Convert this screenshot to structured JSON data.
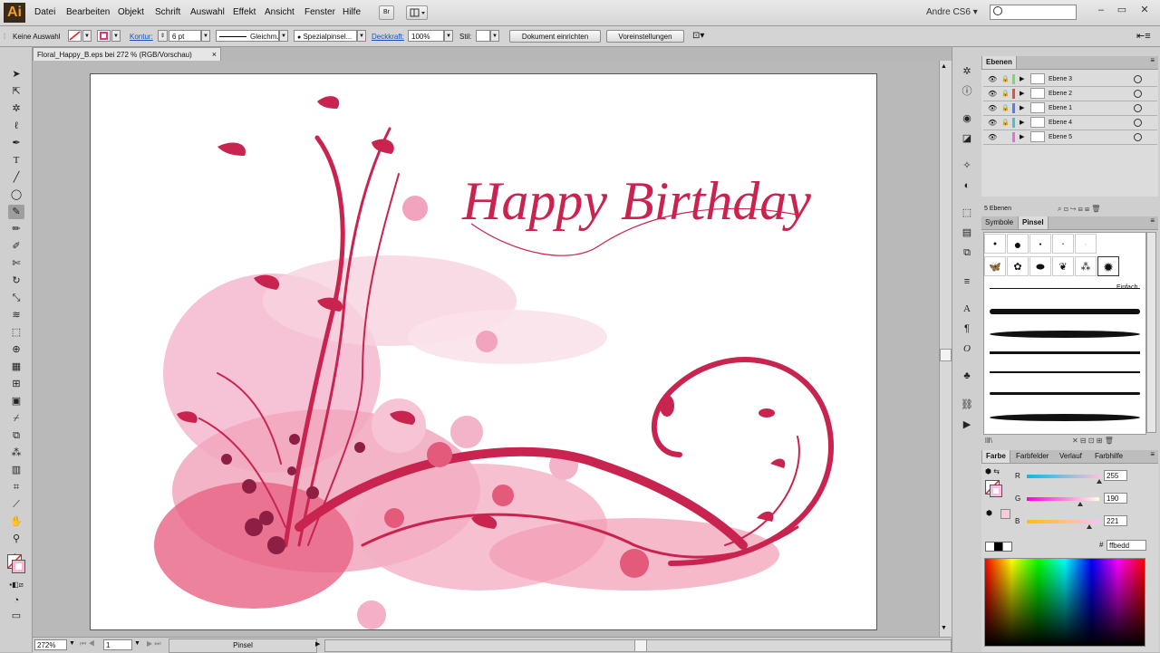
{
  "app": {
    "logo": "Ai",
    "workspace": "Andre CS6 ▾"
  },
  "menu": [
    "Datei",
    "Bearbeiten",
    "Objekt",
    "Schrift",
    "Auswahl",
    "Effekt",
    "Ansicht",
    "Fenster",
    "Hilfe"
  ],
  "menu_accel": [
    "D",
    "B",
    "O",
    "S",
    "A",
    "f",
    "A",
    "F",
    "H"
  ],
  "menubar_buttons": {
    "bridge": "Br"
  },
  "controlbar": {
    "selection": "Keine Auswahl",
    "kontur_label": "Kontur:",
    "stroke_weight": "6 pt",
    "profile": "Gleichm.",
    "brush": "Spezialpinsel...",
    "opacity_label": "Deckkraft:",
    "opacity": "100%",
    "style_label": "Stil:",
    "doc_setup": "Dokument einrichten",
    "preferences": "Voreinstellungen"
  },
  "document": {
    "tab_title": "Floral_Happy_B.eps bei 272 % (RGB/Vorschau)",
    "close": "×"
  },
  "artwork": {
    "text": "Happy Birthday",
    "accent": "#c8244f",
    "splash": "#f2a3bd"
  },
  "statusbar": {
    "zoom": "272%",
    "page": "1",
    "tool": "Pinsel"
  },
  "layers_panel": {
    "tab": "Ebenen",
    "rows": [
      {
        "name": "Ebene 3",
        "color": "#6ee06e",
        "selected": true
      },
      {
        "name": "Ebene 2",
        "color": "#e05050"
      },
      {
        "name": "Ebene 1",
        "color": "#5a7af0"
      },
      {
        "name": "Ebene 4",
        "color": "#50c0c0"
      },
      {
        "name": "Ebene 5",
        "color": "#e070e0"
      }
    ],
    "count": "5 Ebenen"
  },
  "brushes_panel": {
    "tabs": [
      "Symbole",
      "Pinsel"
    ],
    "active": "Pinsel",
    "basic_label": "Einfach"
  },
  "color_panel": {
    "tabs": [
      "Farbe",
      "Farbfelder",
      "Verlauf",
      "Farbhilfe"
    ],
    "r": "255",
    "g": "190",
    "b": "221",
    "r_label": "R",
    "g_label": "G",
    "b_label": "B",
    "hash": "#",
    "hex": "ffbedd"
  }
}
